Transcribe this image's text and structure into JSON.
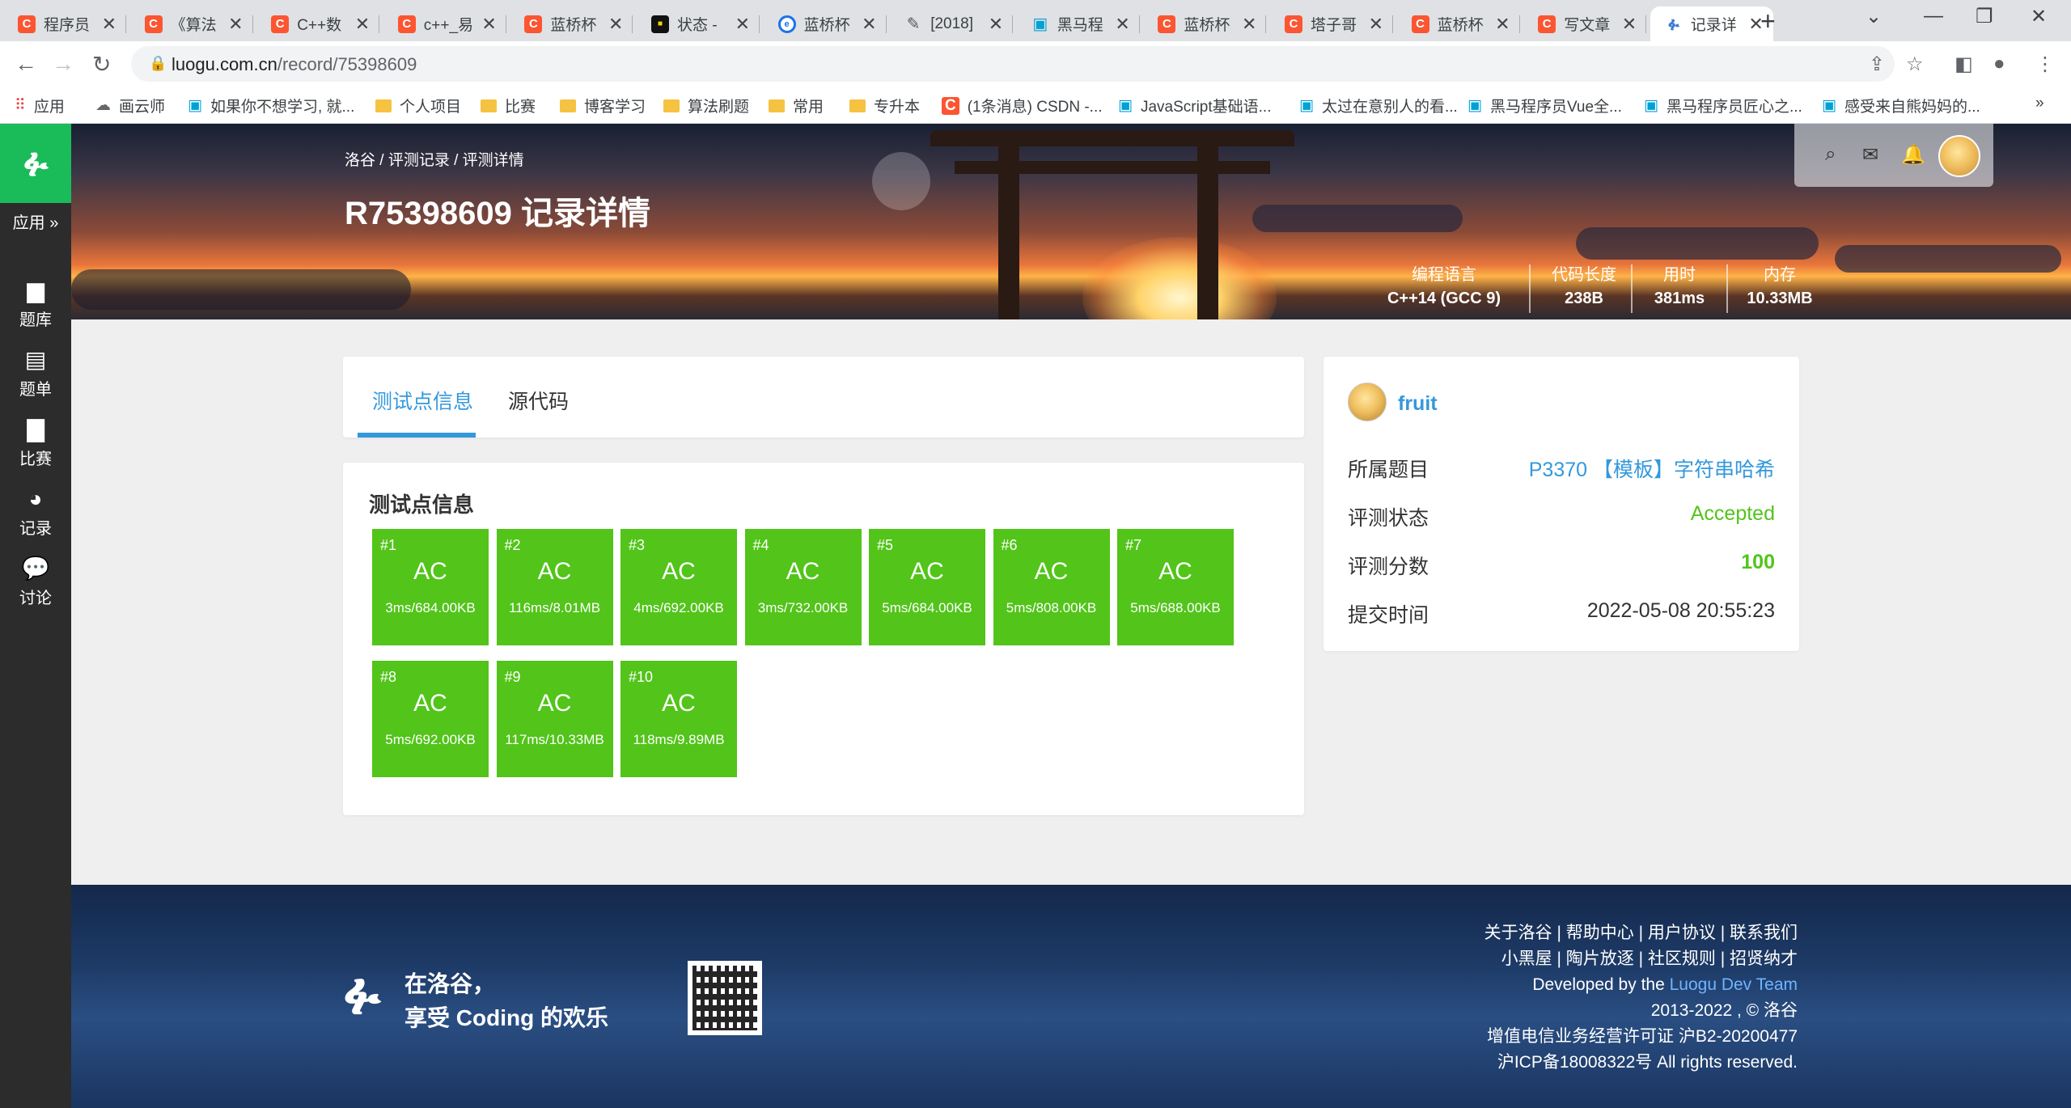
{
  "browser": {
    "tabs": [
      {
        "favicon": "csdn-icon",
        "glyph": "C",
        "label": "程序员"
      },
      {
        "favicon": "csdn-icon",
        "glyph": "C",
        "label": "《算法"
      },
      {
        "favicon": "csdn-icon",
        "glyph": "C",
        "label": "C++数"
      },
      {
        "favicon": "csdn-icon",
        "glyph": "C",
        "label": "c++_易"
      },
      {
        "favicon": "csdn-icon",
        "glyph": "C",
        "label": "蓝桥杯"
      },
      {
        "favicon": "dark-icon",
        "glyph": "■",
        "label": "状态 -"
      },
      {
        "favicon": "blue-circle-icon",
        "glyph": "e",
        "label": "蓝桥杯"
      },
      {
        "favicon": "pen-icon",
        "glyph": "✎",
        "label": "[2018]"
      },
      {
        "favicon": "bilibili-icon",
        "glyph": "▣",
        "label": "黑马程"
      },
      {
        "favicon": "csdn-icon",
        "glyph": "C",
        "label": "蓝桥杯"
      },
      {
        "favicon": "csdn-icon",
        "glyph": "C",
        "label": "塔子哥"
      },
      {
        "favicon": "csdn-icon",
        "glyph": "C",
        "label": "蓝桥杯"
      },
      {
        "favicon": "csdn-icon",
        "glyph": "C",
        "label": "写文章"
      },
      {
        "favicon": "luogu-icon",
        "glyph": "ፉ",
        "label": "记录详"
      }
    ],
    "url_host": "luogu.com.cn",
    "url_path": "/record/75398609",
    "bookmarks": [
      {
        "icon": "apps-icon",
        "label": "应用"
      },
      {
        "icon": "cloud-icon",
        "label": "画云师"
      },
      {
        "icon": "bilibili-icon",
        "label": "如果你不想学习, 就..."
      },
      {
        "icon": "folder-icon",
        "label": "个人项目"
      },
      {
        "icon": "folder-icon",
        "label": "比赛"
      },
      {
        "icon": "folder-icon",
        "label": "博客学习"
      },
      {
        "icon": "folder-icon",
        "label": "算法刷题"
      },
      {
        "icon": "folder-icon",
        "label": "常用"
      },
      {
        "icon": "folder-icon",
        "label": "专升本"
      },
      {
        "icon": "csdn-icon",
        "label": "(1条消息) CSDN -..."
      },
      {
        "icon": "bilibili-icon",
        "label": "JavaScript基础语..."
      },
      {
        "icon": "bilibili-icon",
        "label": "太过在意别人的看..."
      },
      {
        "icon": "bilibili-icon",
        "label": "黑马程序员Vue全..."
      },
      {
        "icon": "bilibili-icon",
        "label": "黑马程序员匠心之..."
      },
      {
        "icon": "bilibili-icon",
        "label": "感受来自熊妈妈的..."
      }
    ],
    "overflow": "»"
  },
  "sidebar": {
    "app_label": "应用",
    "items": [
      {
        "icon": "book-icon",
        "glyph": "▆",
        "label": "题库"
      },
      {
        "icon": "clipboard-icon",
        "glyph": "▤",
        "label": "题单"
      },
      {
        "icon": "bar-chart-icon",
        "glyph": "▇",
        "label": "比赛"
      },
      {
        "icon": "pie-chart-icon",
        "glyph": "◕",
        "label": "记录"
      },
      {
        "icon": "comments-icon",
        "glyph": "💬",
        "label": "讨论"
      }
    ]
  },
  "banner": {
    "breadcrumb": "洛谷 / 评测记录 / 评测详情",
    "title": "R75398609 记录详情",
    "stats": [
      {
        "label": "编程语言",
        "value": "C++14 (GCC 9)"
      },
      {
        "label": "代码长度",
        "value": "238B"
      },
      {
        "label": "用时",
        "value": "381ms"
      },
      {
        "label": "内存",
        "value": "10.33MB"
      }
    ]
  },
  "page_tabs": {
    "cases": "测试点信息",
    "source": "源代码"
  },
  "cases": {
    "title": "测试点信息",
    "items": [
      {
        "num": "#1",
        "result": "AC",
        "info": "3ms/684.00KB"
      },
      {
        "num": "#2",
        "result": "AC",
        "info": "116ms/8.01MB"
      },
      {
        "num": "#3",
        "result": "AC",
        "info": "4ms/692.00KB"
      },
      {
        "num": "#4",
        "result": "AC",
        "info": "3ms/732.00KB"
      },
      {
        "num": "#5",
        "result": "AC",
        "info": "5ms/684.00KB"
      },
      {
        "num": "#6",
        "result": "AC",
        "info": "5ms/808.00KB"
      },
      {
        "num": "#7",
        "result": "AC",
        "info": "5ms/688.00KB"
      },
      {
        "num": "#8",
        "result": "AC",
        "info": "5ms/692.00KB"
      },
      {
        "num": "#9",
        "result": "AC",
        "info": "117ms/10.33MB"
      },
      {
        "num": "#10",
        "result": "AC",
        "info": "118ms/9.89MB"
      }
    ]
  },
  "info": {
    "username": "fruit",
    "rows": [
      {
        "label": "所属题目",
        "value": "P3370 【模板】字符串哈希",
        "color": "#3498db"
      },
      {
        "label": "评测状态",
        "value": "Accepted",
        "color": "#52c41a"
      },
      {
        "label": "评测分数",
        "value": "100",
        "color": "#52c41a"
      },
      {
        "label": "提交时间",
        "value": "2022-05-08 20:55:23",
        "color": "#333333"
      }
    ]
  },
  "footer": {
    "slogan_1": "在洛谷，",
    "slogan_2": "享受 Coding 的欢乐",
    "links_1": [
      "关于洛谷",
      "帮助中心",
      "用户协议",
      "联系我们"
    ],
    "links_2": [
      "小黑屋",
      "陶片放逐",
      "社区规则",
      "招贤纳才"
    ],
    "dev_prefix": "Developed by the ",
    "dev_team": "Luogu Dev Team",
    "copyright": "2013-2022 , © 洛谷",
    "license": "增值电信业务经营许可证 沪B2-20200477",
    "icp": "沪ICP备18008322号 All rights reserved."
  },
  "colors": {
    "accent": "#3498db",
    "ac_green": "#52c41a",
    "logo_green": "#1abc5a"
  }
}
